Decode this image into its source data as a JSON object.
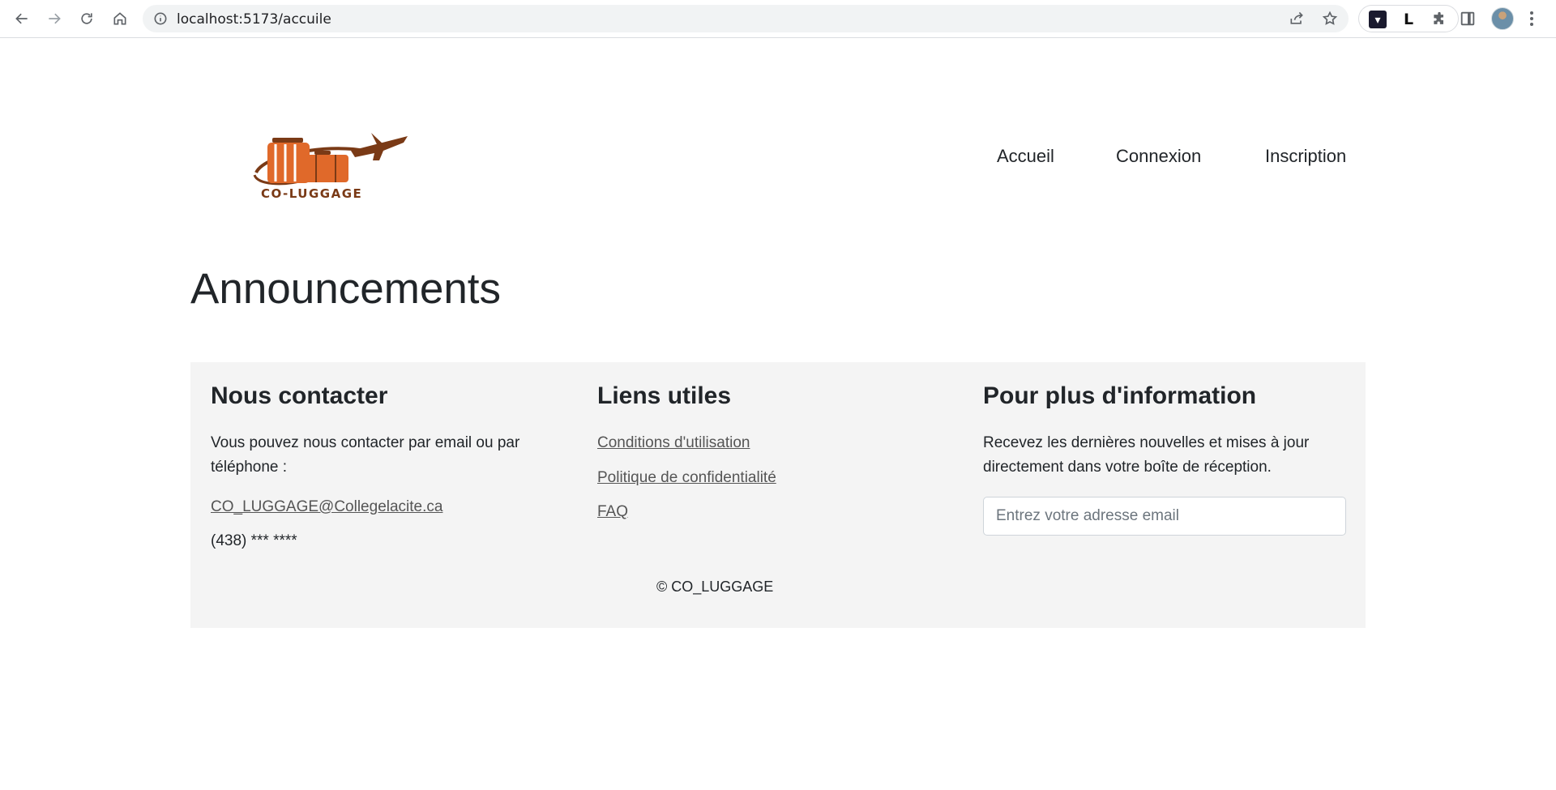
{
  "browser": {
    "url": "localhost:5173/accuile"
  },
  "site": {
    "logo_text": "CO-LUGGAGE",
    "nav": [
      "Accueil",
      "Connexion",
      "Inscription"
    ],
    "page_title": "Announcements"
  },
  "footer": {
    "contact": {
      "title": "Nous contacter",
      "text": "Vous pouvez nous contacter par email ou par téléphone :",
      "email": "CO_LUGGAGE@Collegelacite.ca",
      "phone": "(438) *** ****"
    },
    "links": {
      "title": "Liens utiles",
      "items": [
        "Conditions d'utilisation",
        "Politique de confidentialité",
        "FAQ"
      ]
    },
    "newsletter": {
      "title": "Pour plus d'information",
      "text": "Recevez les dernières nouvelles et mises à jour directement dans votre boîte de réception.",
      "email_placeholder": "Entrez votre adresse email"
    },
    "copyright": "© CO_LUGGAGE"
  },
  "colors": {
    "logo_orange": "#e0692a",
    "logo_brown": "#7a3a16",
    "footer_bg": "#f4f4f4"
  }
}
